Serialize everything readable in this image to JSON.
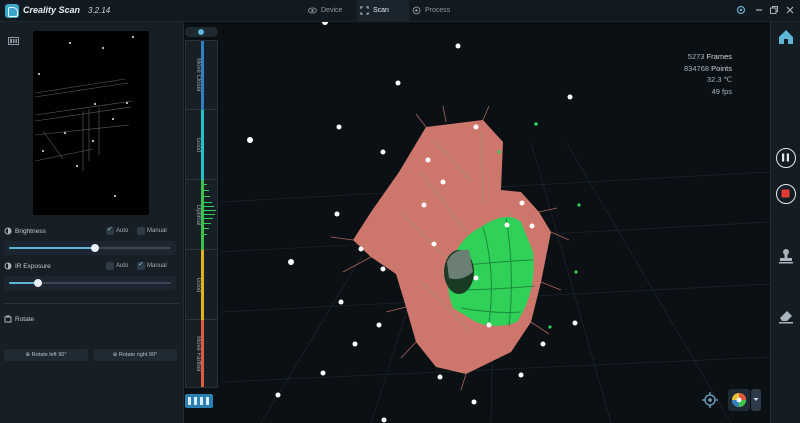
{
  "app": {
    "title": "Creality Scan",
    "version": "3.2.14",
    "tabs": [
      {
        "label": "Device",
        "icon": "eye-icon",
        "active": false
      },
      {
        "label": "Scan",
        "icon": "scan-icon",
        "active": true
      },
      {
        "label": "Process",
        "icon": "process-icon",
        "active": false
      }
    ],
    "window_buttons": [
      "settings-icon",
      "minimize-icon",
      "restore-icon",
      "close-icon"
    ]
  },
  "left_panel": {
    "brightness": {
      "label": "Brightness",
      "auto_label": "Auto",
      "manual_label": "Manual",
      "auto_checked": true,
      "manual_checked": false,
      "level": 0.53
    },
    "ir_exposure": {
      "label": "IR Exposure",
      "auto_label": "Auto",
      "manual_label": "Manual",
      "auto_checked": false,
      "manual_checked": true,
      "level": 0.18
    },
    "rotate": {
      "label": "Rotate",
      "left_label": "Rotate left 90°",
      "right_label": "Rotate right 90°"
    }
  },
  "distance_gauge": {
    "zones": [
      {
        "label": "Move Closer",
        "color": "#2f7fc4"
      },
      {
        "label": "Good",
        "color": "#27c0c8"
      },
      {
        "label": "Optimal",
        "color": "#3cc24a"
      },
      {
        "label": "Good",
        "color": "#e2b21e"
      },
      {
        "label": "Move Farther",
        "color": "#e05a3a"
      }
    ]
  },
  "stats": {
    "frames_value": "5273",
    "frames_unit": "Frames",
    "points_value": "834768",
    "points_unit": "Points",
    "temperature": "32.3 ℃",
    "fps": "49 fps"
  },
  "right_toolbar": [
    "home-icon",
    "pause-icon",
    "stop-icon",
    "stamp-icon",
    "eraser-icon"
  ],
  "colors": {
    "accent": "#5fb7d8",
    "record": "#e23b36",
    "mesh_green": "#2fd158",
    "cloud_salmon": "#f08a7b"
  }
}
